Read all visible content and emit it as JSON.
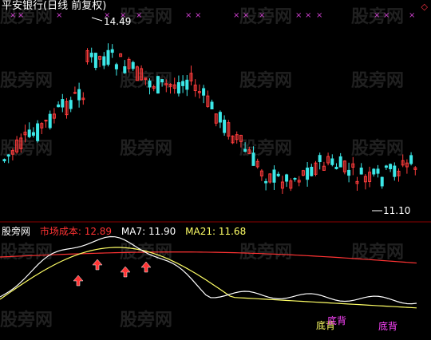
{
  "header": {
    "title": "平安银行(日线 前复权)",
    "corner_icon": "diamond-icon"
  },
  "watermark": "股旁网",
  "price_chart": {
    "high_label": "14.49",
    "low_label": "11.10",
    "colors": {
      "up": "#ff3c3c",
      "down": "#3ce8e8",
      "cross": "#d040d0",
      "grid": "#8b0000"
    }
  },
  "indicator": {
    "name": "股旁网",
    "items": [
      {
        "label": "市场成本: ",
        "value": "12.89",
        "color": "#ff3333"
      },
      {
        "label": "MA7: ",
        "value": "11.90",
        "color": "#ffffff"
      },
      {
        "label": "MA21: ",
        "value": "11.68",
        "color": "#ffff66"
      }
    ],
    "signals": [
      {
        "text": "底背",
        "color": "#ffff66"
      },
      {
        "text": "底背",
        "color": "#ff44ff"
      },
      {
        "text": "底背",
        "color": "#ff44ff"
      }
    ]
  }
}
